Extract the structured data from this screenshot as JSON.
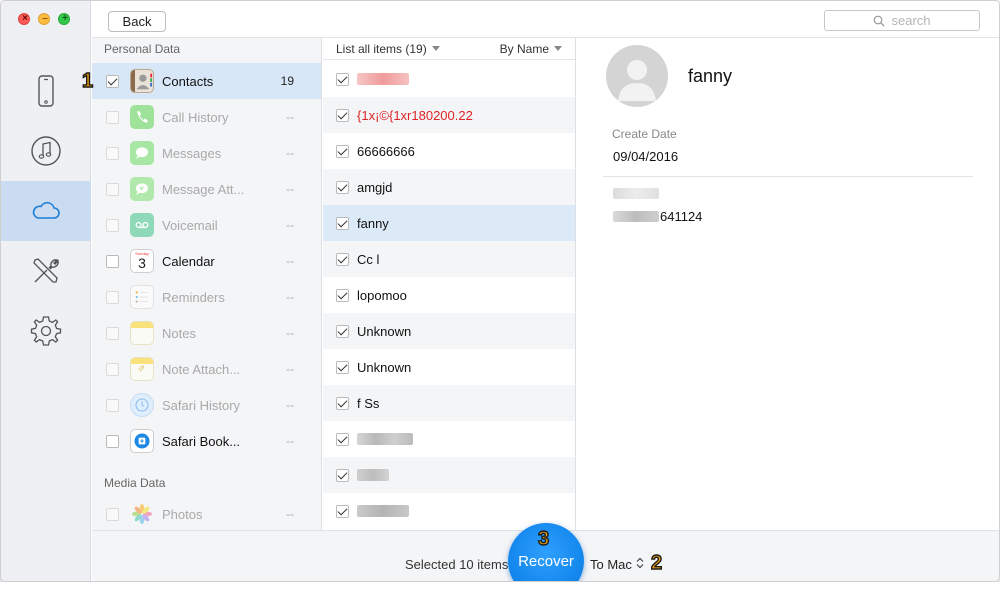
{
  "window": {
    "traffic_lights": {
      "close_glyph": "×",
      "minimize_glyph": "–",
      "zoom_glyph": "+"
    }
  },
  "sidebar": {
    "items": [
      {
        "name": "phone-icon",
        "active": false
      },
      {
        "name": "music-note-icon",
        "active": false
      },
      {
        "name": "cloud-icon",
        "active": true
      },
      {
        "name": "tools-icon",
        "active": false
      },
      {
        "name": "gear-icon",
        "active": false
      }
    ]
  },
  "toolbar": {
    "back_label": "Back",
    "search_placeholder": "search"
  },
  "categories": {
    "personal_header": "Personal Data",
    "media_header": "Media Data",
    "items": [
      {
        "label": "Contacts",
        "count": "19",
        "checked": true,
        "enabled": true,
        "icon": "contacts-icon"
      },
      {
        "label": "Call History",
        "count": "--",
        "checked": false,
        "enabled": false,
        "icon": "phone-call-icon"
      },
      {
        "label": "Messages",
        "count": "--",
        "checked": false,
        "enabled": false,
        "icon": "messages-icon"
      },
      {
        "label": "Message Att...",
        "count": "--",
        "checked": false,
        "enabled": false,
        "icon": "message-attachment-icon"
      },
      {
        "label": "Voicemail",
        "count": "--",
        "checked": false,
        "enabled": false,
        "icon": "voicemail-icon"
      },
      {
        "label": "Calendar",
        "count": "--",
        "checked": false,
        "enabled": true,
        "icon": "calendar-icon",
        "icon_text": "3",
        "icon_day": "Sunday"
      },
      {
        "label": "Reminders",
        "count": "--",
        "checked": false,
        "enabled": false,
        "icon": "reminders-icon"
      },
      {
        "label": "Notes",
        "count": "--",
        "checked": false,
        "enabled": false,
        "icon": "notes-icon"
      },
      {
        "label": "Note Attach...",
        "count": "--",
        "checked": false,
        "enabled": false,
        "icon": "note-attachment-icon"
      },
      {
        "label": "Safari History",
        "count": "--",
        "checked": false,
        "enabled": false,
        "icon": "safari-history-icon"
      },
      {
        "label": "Safari Book...",
        "count": "--",
        "checked": false,
        "enabled": true,
        "icon": "safari-bookmarks-icon"
      }
    ],
    "media_items": [
      {
        "label": "Photos",
        "count": "--",
        "checked": false,
        "enabled": false,
        "icon": "photos-icon"
      }
    ]
  },
  "items_list": {
    "filter_label": "List all items (19)",
    "sort_label": "By Name",
    "rows": [
      {
        "text": "",
        "blurred": true,
        "blur_color": "#f3b0b0"
      },
      {
        "text": "{1x¡©{1xr180200.22",
        "red": true
      },
      {
        "text": "66666666"
      },
      {
        "text": "amgjd"
      },
      {
        "text": "fanny",
        "selected": true
      },
      {
        "text": "Cc l"
      },
      {
        "text": "lopomoo"
      },
      {
        "text": "Unknown"
      },
      {
        "text": "Unknown"
      },
      {
        "text": "f Ss"
      },
      {
        "text": "",
        "blurred": true,
        "blur_color": "#c4c4c4"
      },
      {
        "text": "",
        "blurred": true,
        "blur_color": "#c9c9c9"
      },
      {
        "text": "",
        "blurred": true,
        "blur_color": "#bcbcbc"
      }
    ]
  },
  "details": {
    "name": "fanny",
    "create_date_label": "Create Date",
    "create_date_value": "09/04/2016",
    "phone_visible_suffix": "641124"
  },
  "footer": {
    "selected_text": "Selected 10 items",
    "recover_label": "Recover",
    "destination_label": "To Mac",
    "destination_arrows": "⌃⌄"
  },
  "step_badges": [
    "1",
    "2",
    "3"
  ],
  "colors": {
    "accent": "#1588ee",
    "selection": "#d8e7f7",
    "badge": "#f5a40e",
    "error_text": "#e02424"
  }
}
